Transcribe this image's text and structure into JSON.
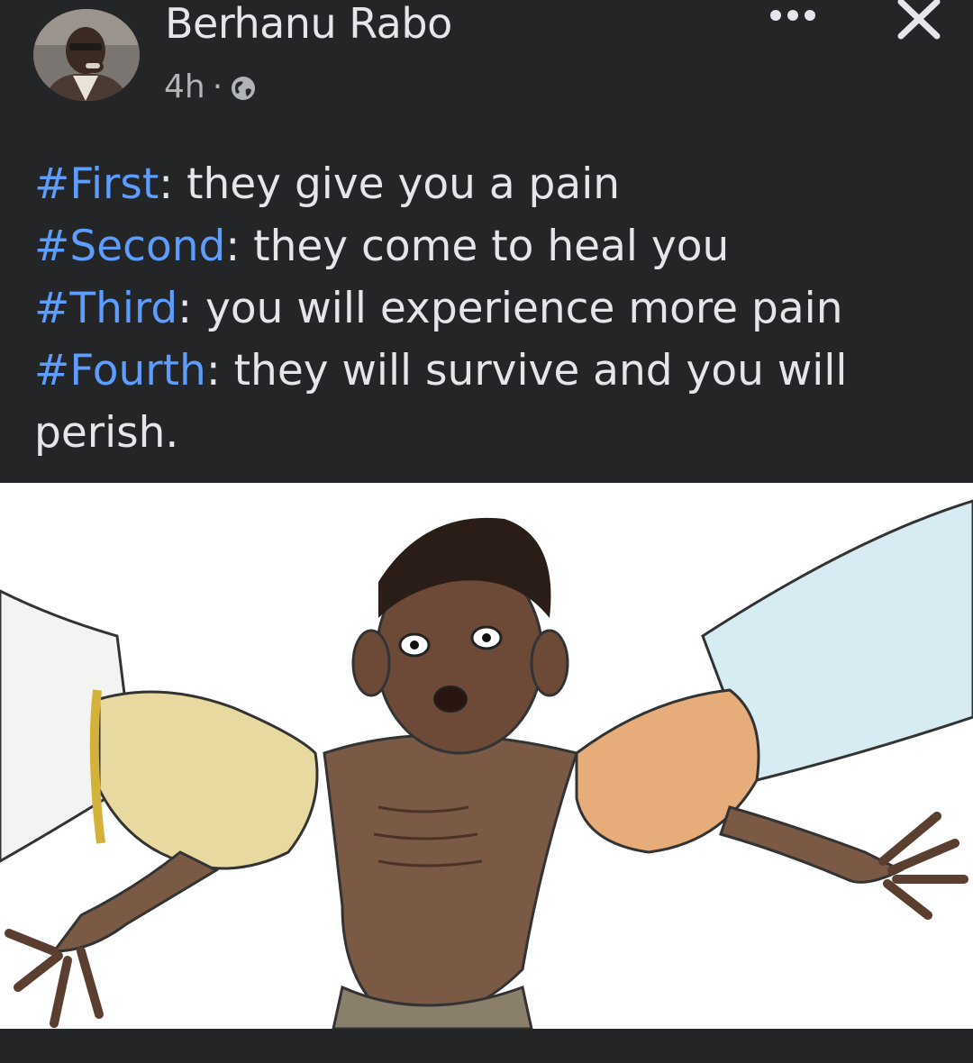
{
  "author": {
    "name": "Berhanu Rabo",
    "timestamp": "4h",
    "separator": "·",
    "audience_icon": "globe-icon"
  },
  "header_actions": {
    "more_icon": "ellipsis-icon",
    "close_icon": "close-icon"
  },
  "post": {
    "lines": [
      {
        "hashtag": "#First",
        "text": ": they give you a pain"
      },
      {
        "hashtag": "#Second",
        "text": ": they come to heal you"
      },
      {
        "hashtag": "#Third",
        "text": ": you will experience more pain"
      },
      {
        "hashtag": "#Fourth",
        "text": ": they will survive and you will perish."
      }
    ]
  },
  "colors": {
    "background": "#242526",
    "text": "#e4e6eb",
    "secondary_text": "#b0b3b8",
    "hashtag": "#5c9dff"
  }
}
